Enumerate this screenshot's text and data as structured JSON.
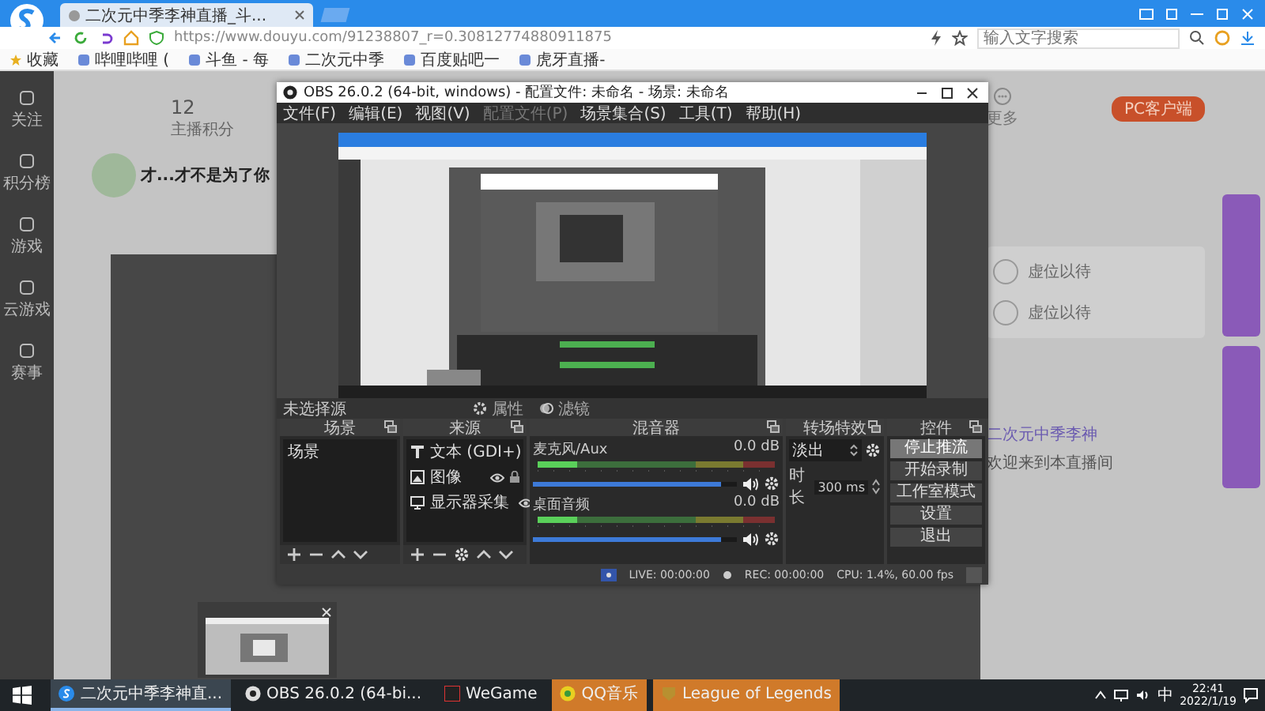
{
  "browser": {
    "tab_title": "二次元中季李神直播_斗...",
    "url": "https://www.douyu.com/91238807_r=0.30812774880911875",
    "search": {
      "placeholder": "输入文字搜索"
    },
    "bookmarks": [
      "收藏",
      "哔哩哔哩 (",
      "斗鱼 - 每",
      "二次元中季",
      "百度贴吧一",
      "虎牙直播-"
    ]
  },
  "page": {
    "sidebar": [
      "关注",
      "积分榜",
      "游戏",
      "云游戏",
      "赛事"
    ],
    "stat": {
      "value": "12",
      "label": "主播积分"
    },
    "stream_title": "才...才不是为了你",
    "client_button": "PC客户端",
    "more": "更多",
    "ranking": [
      "虚位以待",
      "虚位以待"
    ],
    "chat": {
      "user": "二次元中季李神",
      "message": "欢迎来到本直播间"
    }
  },
  "obs": {
    "title": "OBS 26.0.2 (64-bit, windows) - 配置文件: 未命名 - 场景: 未命名",
    "menu": [
      {
        "label": "文件(F)",
        "disabled": false
      },
      {
        "label": "编辑(E)",
        "disabled": false
      },
      {
        "label": "视图(V)",
        "disabled": false
      },
      {
        "label": "配置文件(P)",
        "disabled": true
      },
      {
        "label": "场景集合(S)",
        "disabled": false
      },
      {
        "label": "工具(T)",
        "disabled": false
      },
      {
        "label": "帮助(H)",
        "disabled": false
      }
    ],
    "source_bar": {
      "label": "未选择源",
      "properties": "属性",
      "filters": "滤镜"
    },
    "scenes": {
      "title": "场景",
      "items": [
        "场景"
      ]
    },
    "sources": {
      "title": "来源",
      "items": [
        {
          "label": "文本 (GDI+)",
          "kind": "text"
        },
        {
          "label": "图像",
          "kind": "image"
        },
        {
          "label": "显示器采集",
          "kind": "display"
        }
      ]
    },
    "mixer": {
      "title": "混音器",
      "channels": [
        {
          "name": "麦克风/Aux",
          "reading": "0.0 dB",
          "level": 0.92
        },
        {
          "name": "桌面音频",
          "reading": "0.0 dB",
          "level": 0.92
        }
      ]
    },
    "transitions": {
      "title": "转场特效",
      "type": "淡出",
      "duration_label": "时长",
      "duration": "300 ms"
    },
    "controls": {
      "title": "控件",
      "buttons": [
        {
          "label": "停止推流",
          "active": true
        },
        {
          "label": "开始录制",
          "active": false
        },
        {
          "label": "工作室模式",
          "active": false
        },
        {
          "label": "设置",
          "active": false
        },
        {
          "label": "退出",
          "active": false
        }
      ]
    },
    "status": {
      "live": "LIVE: 00:00:00",
      "rec": "REC: 00:00:00",
      "cpu": "CPU: 1.4%, 60.00 fps"
    }
  },
  "taskbar": {
    "items": [
      {
        "label": "二次元中季李神直...",
        "kind": "browser",
        "selected": true,
        "flashing": false
      },
      {
        "label": "OBS 26.0.2 (64-bi...",
        "kind": "obs",
        "selected": false,
        "flashing": false
      },
      {
        "label": "WeGame",
        "kind": "wegame",
        "selected": false,
        "flashing": false
      },
      {
        "label": "QQ音乐",
        "kind": "music",
        "selected": false,
        "flashing": true
      },
      {
        "label": "League of Legends",
        "kind": "game",
        "selected": false,
        "flashing": true
      }
    ],
    "ime": "中",
    "time": "22:41",
    "date": "2022/1/19"
  }
}
